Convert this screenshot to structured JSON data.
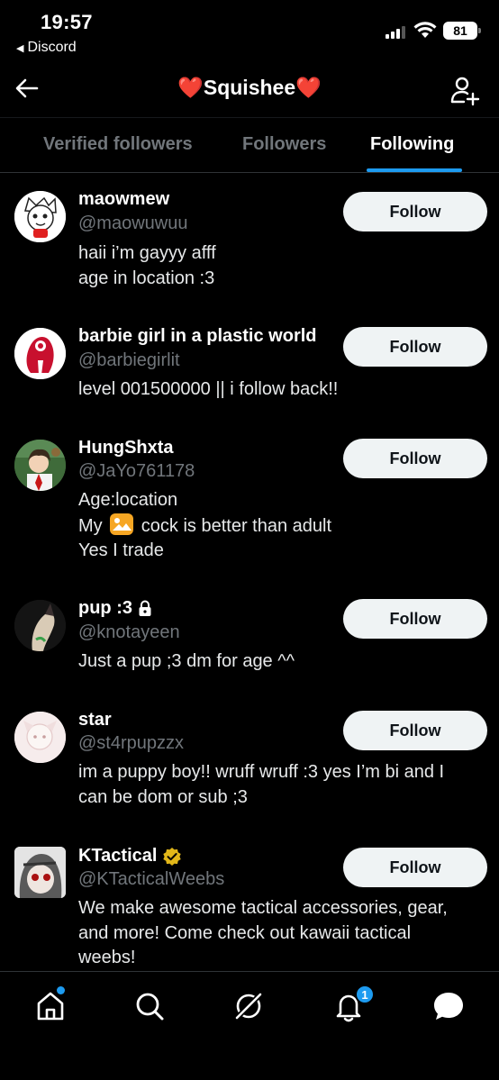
{
  "status": {
    "time": "19:57",
    "back_app": "Discord",
    "battery": "81"
  },
  "header": {
    "title_prefix": "❤️",
    "title": "Squishee",
    "title_suffix": "❤️"
  },
  "tabs": [
    {
      "label": "Verified followers"
    },
    {
      "label": "Followers"
    },
    {
      "label": "Following"
    }
  ],
  "follow_label": "Follow",
  "users": [
    {
      "name": "maowmew",
      "handle": "@maowuwuu",
      "bio": [
        "haii i’m gayyy afff",
        "age in location :3"
      ]
    },
    {
      "name": "barbie girl in a plastic world",
      "handle": "@barbiegirlit",
      "bio": [
        "level 001500000 || i follow back!!"
      ]
    },
    {
      "name": "HungShxta",
      "handle": "@JaYo761178",
      "bio": [
        "Age:location",
        "My",
        "cock is better than adult",
        "Yes I trade"
      ]
    },
    {
      "name": "pup :3",
      "handle": "@knotayeen",
      "bio": [
        "Just a pup ;3 dm for age ^^"
      ]
    },
    {
      "name": "star",
      "handle": "@st4rpupzzx",
      "bio": [
        "im a puppy boy!! wruff wruff :3 yes I’m bi and I",
        "can be dom or sub ;3"
      ]
    },
    {
      "name": "KTactical",
      "handle": "@KTacticalWeebs",
      "bio": [
        "We make awesome tactical accessories, gear,",
        "and more! Come check out kawaii tactical",
        "weebs!"
      ]
    }
  ],
  "icons": {
    "protected": "lock-icon",
    "verified": "verified-badge-icon"
  },
  "nav": {
    "notifications_count": "1"
  },
  "colors": {
    "accent": "#1d9bf0",
    "background": "#000000",
    "muted": "#71767b",
    "heart": "#f0243a",
    "verified": "#e2b719"
  }
}
